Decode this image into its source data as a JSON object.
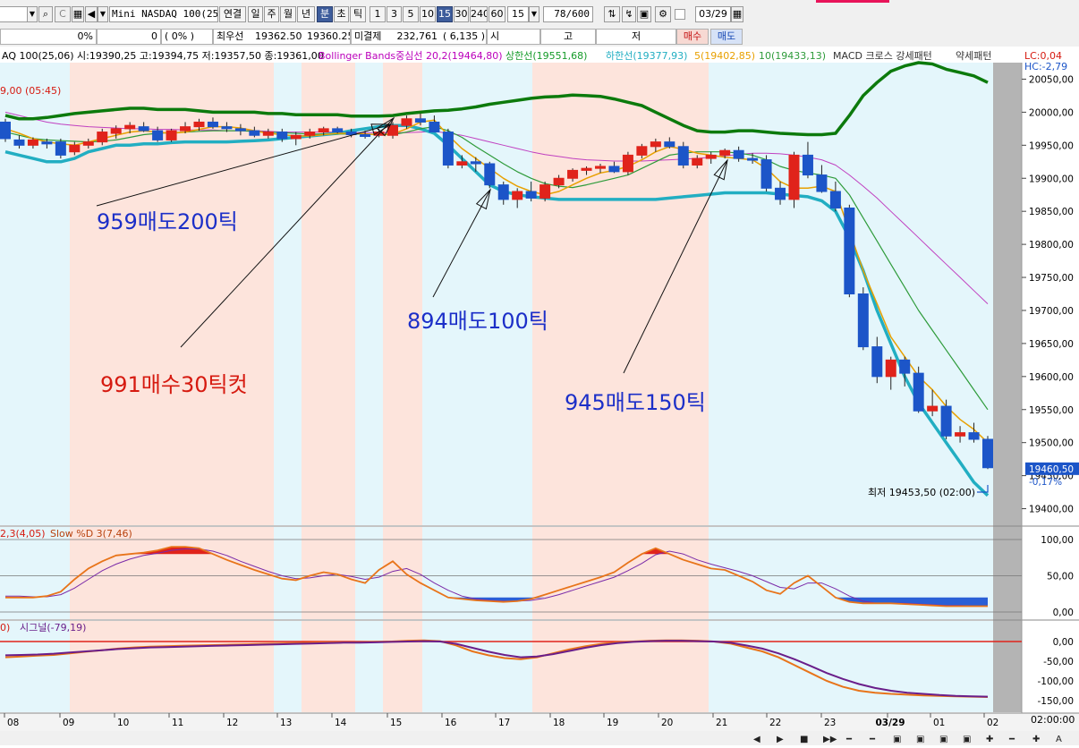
{
  "toolbar": {
    "symbol": "Mini NASDAQ 100(25.0",
    "period_tabs": [
      "연결",
      "일",
      "주",
      "월",
      "년",
      "분",
      "초",
      "틱"
    ],
    "selected_period": "분",
    "intervals": [
      "1",
      "3",
      "5",
      "10",
      "15",
      "30",
      "240",
      "60"
    ],
    "selected_interval": "15",
    "interval_value": "15",
    "count_display": "78/600",
    "date_value": "03/29"
  },
  "statusbar": {
    "field_pct": "0%",
    "field_zero": "0",
    "field_paren": "(      0%  )",
    "best_label": "최우선",
    "best_ask": "19362.50",
    "best_bid": "19360.25",
    "unsettled_label": "미결제",
    "unsettled_value": "232,761",
    "unsettled_change": "( 6,135  )",
    "open_label": "시",
    "high_label": "고",
    "low_label": "저",
    "buy_button": "매수",
    "sell_button": "매도"
  },
  "header": {
    "symbol_info": "AQ 100(25,06) 시:19390,25 고:19394,75 저:19357,50 종:19361,00",
    "bb_label": "Bollinger Bands중심선 20,2(19464,80)",
    "upper_label": "상한선(19551,68)",
    "lower_label": "하한선(19377,93)",
    "ma5_label": "5(19402,85)",
    "ma10_label": "10(19433,13)",
    "macd_label": "MACD 크로스 강세패턴",
    "weak_label": "약세패턴",
    "lc": "LC:0,04",
    "hc": "HC:-2,79",
    "left_value": "9,00 (05:45)"
  },
  "colors": {
    "up": "#e0231b",
    "down": "#1c55c8",
    "bb_upper": "#0c7a0c",
    "bb_lower": "#22aec2",
    "ma5": "#e8a000",
    "ma10": "#2e9b3a",
    "ma_long": "#c040c0",
    "band_pink": "#fde4dc",
    "band_blue": "#e4f6fb",
    "annot_blue": "#1c2fc8",
    "annot_red": "#d61a10",
    "axis_bg": "#b4b4b4"
  },
  "annotations": [
    {
      "text": "959매도200틱",
      "color": "blue"
    },
    {
      "text": "991매수30틱컷",
      "color": "red"
    },
    {
      "text": "894매도100틱",
      "color": "blue"
    },
    {
      "text": "945매도150틱",
      "color": "blue"
    }
  ],
  "price_labels": [
    "20050,00",
    "20000,00",
    "19950,00",
    "19900,00",
    "19850,00",
    "19800,00",
    "19750,00",
    "19700,00",
    "19650,00",
    "19600,00",
    "19550,00",
    "19500,00",
    "19450,00",
    "19400,00"
  ],
  "current_price": "19460,50",
  "current_change": "-0,17%",
  "low_marker": "최저 19453,50 (02:00)",
  "stoch": {
    "header_left": "2,3(4,05)",
    "header_label": "Slow %D 3(7,46)",
    "labels": [
      "100,00",
      "50,00",
      "0,00"
    ]
  },
  "macd": {
    "header_left": "0)",
    "header_label": "시그널(-79,19)",
    "labels": [
      "0,00",
      "-50,00",
      "-100,00",
      "-150,00"
    ]
  },
  "time_axis": {
    "labels": [
      "08",
      "09",
      "10",
      "11",
      "12",
      "13",
      "14",
      "15",
      "16",
      "17",
      "18",
      "19",
      "20",
      "21",
      "22",
      "23",
      "03/29",
      "01",
      "02"
    ],
    "corner": "02:00:00"
  },
  "chart_data": {
    "type": "candlestick",
    "ylim": [
      19375,
      20075
    ],
    "x_labels": [
      "08",
      "09",
      "10",
      "11",
      "12",
      "13",
      "14",
      "15",
      "16",
      "17",
      "18",
      "19",
      "20",
      "21",
      "22",
      "23",
      "03/29",
      "01",
      "02"
    ],
    "candles": [
      [
        19985,
        19990,
        19955,
        19960
      ],
      [
        19958,
        19965,
        19945,
        19950
      ],
      [
        19950,
        19962,
        19945,
        19958
      ],
      [
        19955,
        19960,
        19945,
        19952
      ],
      [
        19955,
        19960,
        19930,
        19935
      ],
      [
        19940,
        19955,
        19935,
        19950
      ],
      [
        19950,
        19960,
        19945,
        19955
      ],
      [
        19955,
        19975,
        19950,
        19970
      ],
      [
        19968,
        19980,
        19960,
        19975
      ],
      [
        19975,
        19985,
        19968,
        19980
      ],
      [
        19978,
        19985,
        19970,
        19972
      ],
      [
        19972,
        19978,
        19955,
        19958
      ],
      [
        19958,
        19975,
        19955,
        19972
      ],
      [
        19972,
        19985,
        19968,
        19978
      ],
      [
        19978,
        19990,
        19972,
        19985
      ],
      [
        19985,
        19992,
        19975,
        19978
      ],
      [
        19978,
        19985,
        19970,
        19975
      ],
      [
        19975,
        19982,
        19965,
        19972
      ],
      [
        19972,
        19978,
        19962,
        19965
      ],
      [
        19965,
        19975,
        19960,
        19970
      ],
      [
        19970,
        19975,
        19955,
        19960
      ],
      [
        19960,
        19970,
        19950,
        19965
      ],
      [
        19965,
        19975,
        19960,
        19970
      ],
      [
        19970,
        19978,
        19965,
        19975
      ],
      [
        19975,
        19978,
        19968,
        19970
      ],
      [
        19970,
        19975,
        19962,
        19966
      ],
      [
        19966,
        19972,
        19960,
        19965
      ],
      [
        19965,
        19975,
        19962,
        19970
      ],
      [
        19965,
        19985,
        19960,
        19980
      ],
      [
        19980,
        19995,
        19975,
        19990
      ],
      [
        19990,
        19998,
        19980,
        19985
      ],
      [
        19985,
        19995,
        19978,
        19970
      ],
      [
        19970,
        19975,
        19915,
        19920
      ],
      [
        19920,
        19935,
        19915,
        19925
      ],
      [
        19925,
        19932,
        19910,
        19922
      ],
      [
        19922,
        19925,
        19885,
        19890
      ],
      [
        19890,
        19895,
        19860,
        19868
      ],
      [
        19868,
        19885,
        19855,
        19880
      ],
      [
        19880,
        19895,
        19865,
        19870
      ],
      [
        19870,
        19895,
        19865,
        19890
      ],
      [
        19890,
        19905,
        19885,
        19900
      ],
      [
        19900,
        19915,
        19895,
        19912
      ],
      [
        19912,
        19918,
        19905,
        19915
      ],
      [
        19915,
        19922,
        19908,
        19918
      ],
      [
        19918,
        19925,
        19908,
        19910
      ],
      [
        19910,
        19940,
        19905,
        19935
      ],
      [
        19935,
        19952,
        19930,
        19948
      ],
      [
        19948,
        19960,
        19940,
        19955
      ],
      [
        19955,
        19962,
        19945,
        19948
      ],
      [
        19948,
        19955,
        19915,
        19920
      ],
      [
        19920,
        19935,
        19915,
        19930
      ],
      [
        19930,
        19940,
        19922,
        19935
      ],
      [
        19935,
        19945,
        19930,
        19942
      ],
      [
        19942,
        19948,
        19925,
        19930
      ],
      [
        19930,
        19938,
        19922,
        19928
      ],
      [
        19928,
        19935,
        19880,
        19885
      ],
      [
        19885,
        19895,
        19860,
        19868
      ],
      [
        19868,
        19940,
        19855,
        19935
      ],
      [
        19935,
        19955,
        19900,
        19905
      ],
      [
        19905,
        19920,
        19878,
        19880
      ],
      [
        19880,
        19895,
        19850,
        19855
      ],
      [
        19855,
        19860,
        19720,
        19725
      ],
      [
        19725,
        19735,
        19640,
        19645
      ],
      [
        19645,
        19660,
        19590,
        19600
      ],
      [
        19600,
        19630,
        19580,
        19625
      ],
      [
        19625,
        19630,
        19585,
        19605
      ],
      [
        19605,
        19615,
        19545,
        19548
      ],
      [
        19548,
        19580,
        19540,
        19555
      ],
      [
        19555,
        19565,
        19505,
        19510
      ],
      [
        19510,
        19525,
        19500,
        19515
      ],
      [
        19515,
        19530,
        19500,
        19505
      ],
      [
        19505,
        19510,
        19460,
        19462
      ]
    ],
    "bb_upper": [
      19995,
      19990,
      19990,
      19992,
      19995,
      19998,
      20000,
      20002,
      20004,
      20006,
      20006,
      20004,
      20004,
      20004,
      20002,
      20000,
      20000,
      20000,
      20000,
      19998,
      19998,
      19996,
      19996,
      19996,
      19996,
      19994,
      19994,
      19994,
      19995,
      19998,
      20000,
      20002,
      20003,
      20005,
      20008,
      20012,
      20015,
      20018,
      20021,
      20023,
      20024,
      20026,
      20025,
      20024,
      20020,
      20015,
      20010,
      20000,
      19990,
      19980,
      19972,
      19970,
      19970,
      19972,
      19972,
      19970,
      19968,
      19967,
      19966,
      19966,
      19968,
      19995,
      20025,
      20045,
      20062,
      20070,
      20075,
      20073,
      20065,
      20060,
      20055,
      20045
    ],
    "bb_lower": [
      19940,
      19935,
      19930,
      19925,
      19925,
      19930,
      19940,
      19945,
      19950,
      19950,
      19952,
      19952,
      19954,
      19955,
      19955,
      19955,
      19955,
      19956,
      19957,
      19958,
      19960,
      19962,
      19964,
      19966,
      19968,
      19972,
      19975,
      19978,
      19980,
      19980,
      19975,
      19968,
      19950,
      19930,
      19910,
      19890,
      19880,
      19875,
      19872,
      19870,
      19868,
      19868,
      19868,
      19868,
      19868,
      19868,
      19868,
      19868,
      19870,
      19872,
      19874,
      19876,
      19878,
      19878,
      19878,
      19878,
      19876,
      19874,
      19872,
      19866,
      19850,
      19810,
      19760,
      19700,
      19650,
      19600,
      19560,
      19530,
      19500,
      19470,
      19440,
      19420
    ],
    "ma5": [
      19975,
      19968,
      19960,
      19955,
      19952,
      19950,
      19955,
      19960,
      19965,
      19970,
      19972,
      19970,
      19968,
      19970,
      19974,
      19978,
      19978,
      19976,
      19972,
      19968,
      19966,
      19964,
      19964,
      19966,
      19968,
      19968,
      19967,
      19966,
      19967,
      19975,
      19985,
      19988,
      19965,
      19945,
      19930,
      19915,
      19900,
      19888,
      19880,
      19875,
      19880,
      19890,
      19900,
      19908,
      19912,
      19918,
      19928,
      19940,
      19948,
      19944,
      19938,
      19935,
      19932,
      19930,
      19928,
      19915,
      19895,
      19885,
      19885,
      19888,
      19880,
      19820,
      19760,
      19710,
      19660,
      19630,
      19600,
      19580,
      19555,
      19535,
      19520,
      19500
    ],
    "ma10": [
      19970,
      19965,
      19960,
      19958,
      19957,
      19956,
      19955,
      19956,
      19958,
      19962,
      19966,
      19968,
      19969,
      19970,
      19971,
      19972,
      19972,
      19972,
      19971,
      19970,
      19969,
      19968,
      19967,
      19967,
      19967,
      19967,
      19967,
      19966,
      19966,
      19970,
      19975,
      19978,
      19972,
      19962,
      19948,
      19935,
      19922,
      19910,
      19900,
      19892,
      19888,
      19886,
      19890,
      19895,
      19900,
      19905,
      19915,
      19925,
      19935,
      19938,
      19940,
      19940,
      19940,
      19938,
      19935,
      19928,
      19918,
      19912,
      19908,
      19905,
      19900,
      19875,
      19840,
      19805,
      19770,
      19735,
      19700,
      19670,
      19640,
      19610,
      19580,
      19550
    ],
    "ma_long": [
      20000,
      19995,
      19990,
      19985,
      19982,
      19980,
      19978,
      19977,
      19976,
      19975,
      19975,
      19974,
      19974,
      19973,
      19973,
      19973,
      19972,
      19972,
      19972,
      19971,
      19970,
      19970,
      19970,
      19970,
      19970,
      19969,
      19969,
      19969,
      19969,
      19969,
      19970,
      19971,
      19968,
      19965,
      19960,
      19955,
      19950,
      19945,
      19940,
      19936,
      19933,
      19930,
      19928,
      19927,
      19926,
      19926,
      19926,
      19927,
      19928,
      19929,
      19930,
      19932,
      19934,
      19936,
      19938,
      19938,
      19937,
      19935,
      19932,
      19928,
      19920,
      19905,
      19888,
      19870,
      19850,
      19830,
      19810,
      19790,
      19770,
      19750,
      19730,
      19710
    ],
    "stoch_k": [
      20,
      20,
      20,
      22,
      28,
      45,
      60,
      70,
      78,
      80,
      82,
      85,
      90,
      90,
      88,
      80,
      72,
      65,
      58,
      52,
      46,
      44,
      50,
      55,
      52,
      45,
      40,
      58,
      70,
      52,
      40,
      30,
      20,
      18,
      16,
      15,
      14,
      15,
      18,
      24,
      30,
      36,
      42,
      48,
      55,
      68,
      80,
      88,
      80,
      72,
      66,
      60,
      58,
      50,
      42,
      30,
      25,
      40,
      50,
      35,
      20,
      14,
      12,
      12,
      12,
      11,
      10,
      9,
      8,
      8,
      8,
      8
    ],
    "stoch_d": [
      22,
      22,
      21,
      21,
      24,
      33,
      45,
      57,
      66,
      73,
      78,
      81,
      85,
      87,
      87,
      84,
      78,
      70,
      63,
      56,
      50,
      46,
      47,
      50,
      52,
      49,
      45,
      48,
      56,
      60,
      52,
      40,
      30,
      22,
      18,
      16,
      15,
      15,
      16,
      19,
      24,
      30,
      36,
      42,
      48,
      57,
      67,
      79,
      84,
      80,
      72,
      66,
      61,
      56,
      50,
      42,
      34,
      32,
      40,
      40,
      32,
      22,
      15,
      12,
      12,
      12,
      11,
      10,
      9,
      9,
      8,
      8
    ],
    "macd": [
      -40,
      -38,
      -36,
      -34,
      -30,
      -26,
      -22,
      -18,
      -15,
      -13,
      -12,
      -11,
      -10,
      -9,
      -8,
      -7,
      -6,
      -5,
      -4,
      -3,
      -2,
      -2,
      -2,
      -1,
      0,
      2,
      3,
      1,
      -10,
      -25,
      -35,
      -42,
      -45,
      -40,
      -30,
      -20,
      -12,
      -6,
      -2,
      0,
      2,
      3,
      3,
      2,
      0,
      -5,
      -15,
      -25,
      -40,
      -60,
      -80,
      -100,
      -115,
      -125,
      -130,
      -133,
      -135,
      -137,
      -138,
      -139,
      -140,
      -141
    ],
    "macd_signal": [
      -35,
      -34,
      -33,
      -31,
      -28,
      -25,
      -22,
      -19,
      -17,
      -15,
      -14,
      -13,
      -12,
      -11,
      -10,
      -9,
      -8,
      -7,
      -6,
      -5,
      -4,
      -3,
      -3,
      -2,
      -1,
      0,
      1,
      0,
      -6,
      -16,
      -26,
      -34,
      -40,
      -38,
      -32,
      -24,
      -16,
      -9,
      -4,
      -1,
      1,
      2,
      2,
      1,
      0,
      -3,
      -10,
      -18,
      -30,
      -45,
      -62,
      -80,
      -95,
      -108,
      -118,
      -125,
      -130,
      -133,
      -136,
      -138,
      -139,
      -140
    ]
  }
}
